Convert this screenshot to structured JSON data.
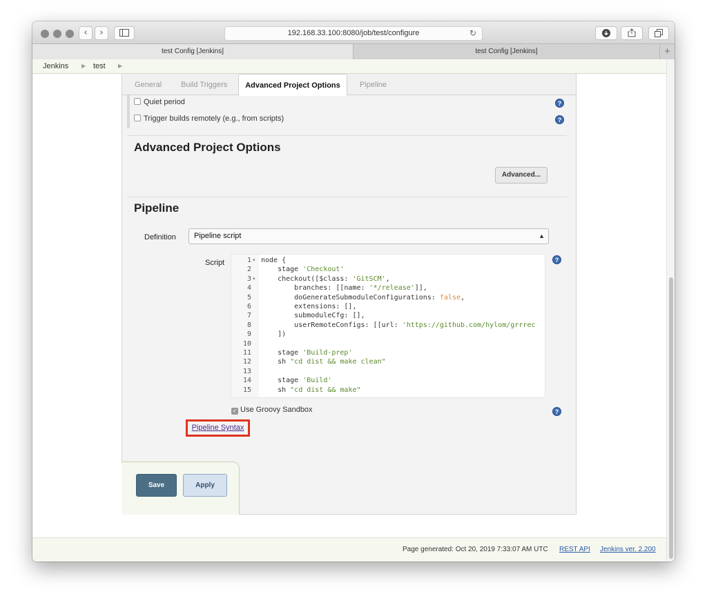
{
  "browser": {
    "url": "192.168.33.100:8080/job/test/configure",
    "tabs": [
      {
        "title": "test Config [Jenkins]",
        "active": true
      },
      {
        "title": "test Config [Jenkins]",
        "active": false
      }
    ]
  },
  "breadcrumb": {
    "items": [
      "Jenkins",
      "test"
    ]
  },
  "config_tabs": [
    "General",
    "Build Triggers",
    "Advanced Project Options",
    "Pipeline"
  ],
  "triggers": {
    "quiet_period": "Quiet period",
    "trigger_remote": "Trigger builds remotely (e.g., from scripts)"
  },
  "advanced_section": {
    "title": "Advanced Project Options",
    "button": "Advanced..."
  },
  "pipeline": {
    "title": "Pipeline",
    "definition_label": "Definition",
    "definition_value": "Pipeline script",
    "script_label": "Script",
    "groovy_sandbox": "Use Groovy Sandbox",
    "syntax_link": "Pipeline Syntax",
    "code": [
      {
        "n": "1",
        "fold": true,
        "text": "node {"
      },
      {
        "n": "2",
        "text": "    stage 'Checkout'"
      },
      {
        "n": "3",
        "fold": true,
        "text": "    checkout([$class: 'GitSCM',"
      },
      {
        "n": "4",
        "text": "        branches: [[name: '*/release']],"
      },
      {
        "n": "5",
        "text": "        doGenerateSubmoduleConfigurations: false,"
      },
      {
        "n": "6",
        "text": "        extensions: [],"
      },
      {
        "n": "7",
        "text": "        submoduleCfg: [],"
      },
      {
        "n": "8",
        "text": "        userRemoteConfigs: [[url: 'https://github.com/hylom/grrrec"
      },
      {
        "n": "9",
        "text": "    ])"
      },
      {
        "n": "10",
        "text": ""
      },
      {
        "n": "11",
        "text": "    stage 'Build-prep'"
      },
      {
        "n": "12",
        "text": "    sh \"cd dist && make clean\""
      },
      {
        "n": "13",
        "text": ""
      },
      {
        "n": "14",
        "text": "    stage 'Build'"
      },
      {
        "n": "15",
        "text": "    sh \"cd dist && make\""
      }
    ]
  },
  "buttons": {
    "save": "Save",
    "apply": "Apply"
  },
  "footer": {
    "generated": "Page generated: Oct 20, 2019 7:33:07 AM UTC",
    "rest_api": "REST API",
    "version": "Jenkins ver. 2.200"
  },
  "icons": {
    "help": "?",
    "dropdown": "▲▼",
    "new_tab": "+",
    "reload": "↻",
    "check": "✓"
  },
  "colors": {
    "save_button": "#4b6f85",
    "highlight_box": "#e0321e",
    "help_icon": "#3c6ab0",
    "string_literal": "#5a8a2a",
    "keyword_false": "#e08a3a"
  }
}
